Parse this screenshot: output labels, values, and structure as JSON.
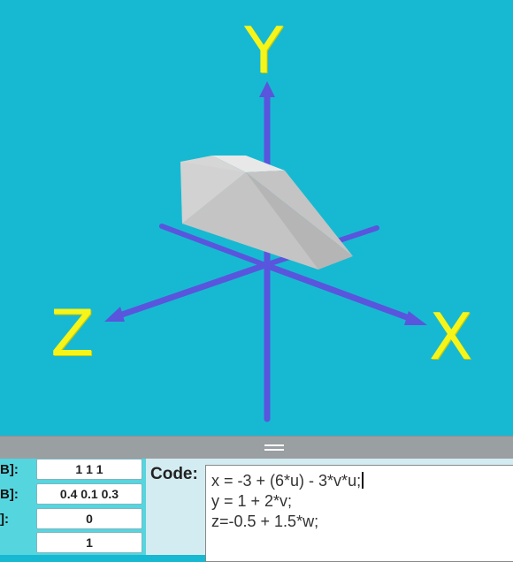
{
  "viewport": {
    "axis_labels": {
      "x": "X",
      "y": "Y",
      "z": "Z"
    },
    "colors": {
      "background": "#17b9d2",
      "axes": "#5a55dd",
      "labels": "#f6f51a",
      "shape": "#c9c9c9"
    }
  },
  "fields": [
    {
      "label": "B]:",
      "value": "1 1 1"
    },
    {
      "label": "B]:",
      "value": "0.4 0.1 0.3"
    },
    {
      "label": "]:",
      "value": "0"
    },
    {
      "label": "",
      "value": "1"
    }
  ],
  "code": {
    "label": "Code:",
    "lines": [
      "x = -3 + (6*u) - 3*v*u;",
      "y = 1 + 2*v;",
      "z=-0.5 + 1.5*w;"
    ]
  },
  "splitter": {
    "icon": "drag-handle-icon"
  }
}
